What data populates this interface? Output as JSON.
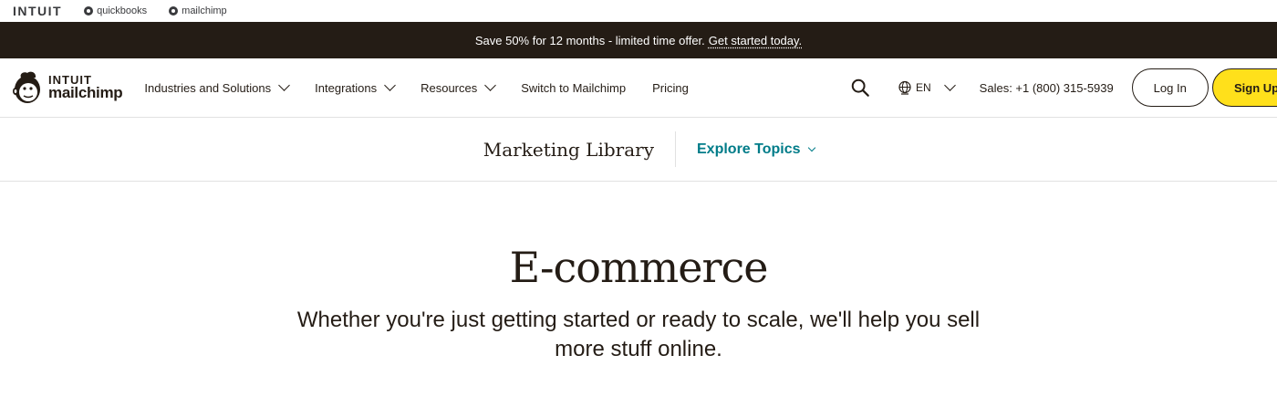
{
  "brand_strip": {
    "intuit": "INTUIT",
    "quickbooks": "quickbooks",
    "mailchimp": "mailchimp"
  },
  "promo": {
    "text": "Save 50% for 12 months - limited time offer.",
    "link": "Get started today."
  },
  "nav": {
    "logo_intuit": "INTUIT",
    "logo_mailchimp": "mailchimp",
    "items": [
      {
        "label": "Industries and Solutions"
      },
      {
        "label": "Integrations"
      },
      {
        "label": "Resources"
      },
      {
        "label": "Switch to Mailchimp"
      },
      {
        "label": "Pricing"
      }
    ],
    "language": "EN",
    "sales": "Sales: +1 (800) 315-5939",
    "login": "Log In",
    "signup": "Sign Up"
  },
  "subnav": {
    "title": "Marketing Library",
    "explore": "Explore Topics"
  },
  "hero": {
    "title": "E-commerce",
    "subtitle": "Whether you're just getting started or ready to scale, we'll help you sell more stuff online."
  },
  "colors": {
    "dark": "#241c15",
    "accent_yellow": "#ffe01b",
    "teal_link": "#007c89",
    "divider": "#e1e1e1"
  }
}
